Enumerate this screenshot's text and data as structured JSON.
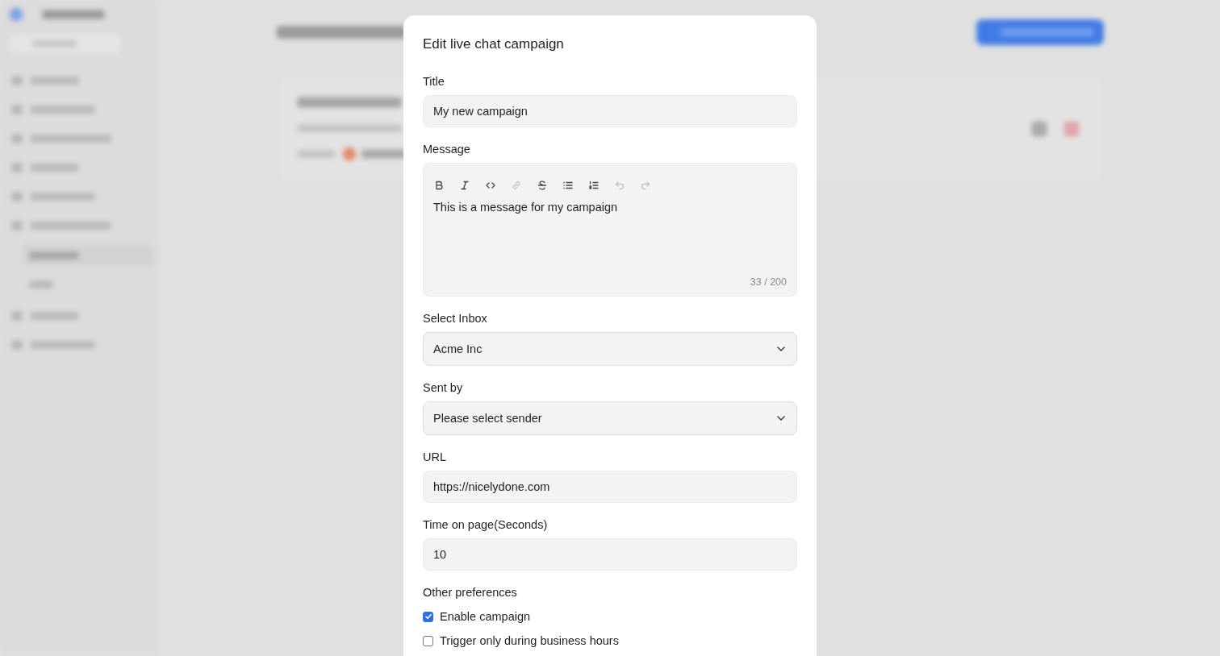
{
  "dialog": {
    "title": "Edit live chat campaign",
    "fields": [
      {
        "kind": "text",
        "label": "Title",
        "value": "My new campaign"
      },
      {
        "kind": "editor",
        "label": "Message",
        "value": "This is a message for my campaign",
        "count": "33 / 200",
        "toolbar": [
          {
            "kind": "bold",
            "disabled": false
          },
          {
            "kind": "italic",
            "disabled": false
          },
          {
            "kind": "code",
            "disabled": false
          },
          {
            "kind": "link",
            "disabled": true
          },
          {
            "kind": "strike",
            "disabled": false
          },
          {
            "kind": "bullet-list",
            "disabled": false
          },
          {
            "kind": "ordered-list",
            "disabled": false
          },
          {
            "kind": "undo",
            "disabled": true
          },
          {
            "kind": "redo",
            "disabled": true
          }
        ]
      },
      {
        "kind": "select",
        "label": "Select Inbox",
        "value": "Acme Inc"
      },
      {
        "kind": "select",
        "label": "Sent by",
        "value": "Please select sender"
      },
      {
        "kind": "text",
        "label": "URL",
        "value": "https://nicelydone.com"
      },
      {
        "kind": "text",
        "label": "Time on page(Seconds)",
        "value": "10"
      }
    ],
    "preferences": {
      "label": "Other preferences",
      "options": [
        {
          "label": "Enable campaign",
          "checked": true
        },
        {
          "label": "Trigger only during business hours",
          "checked": false
        }
      ]
    }
  }
}
